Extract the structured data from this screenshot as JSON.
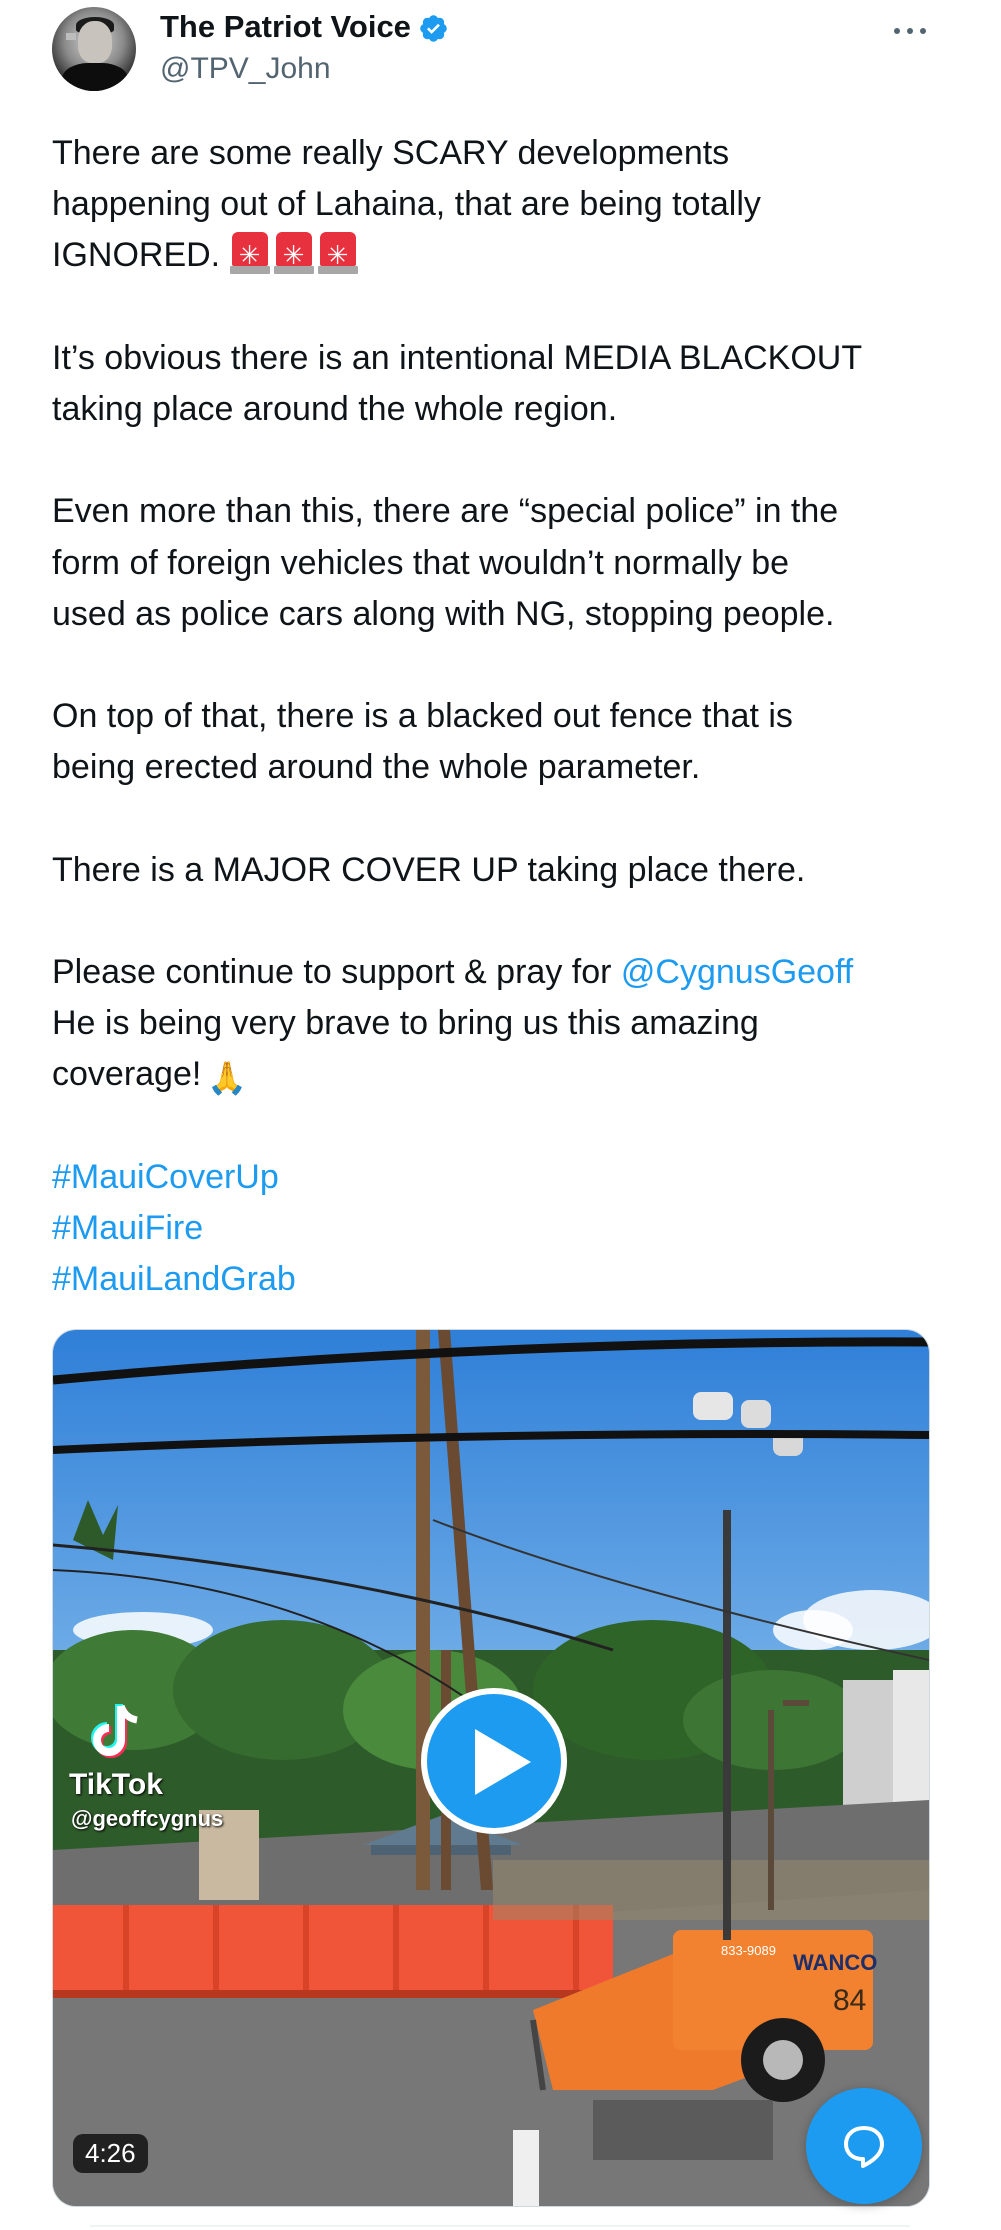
{
  "author": {
    "display_name": "The Patriot Voice",
    "handle": "@TPV_John",
    "verified_icon": "verified-badge-icon",
    "more_icon": "more-horizontal-icon"
  },
  "tweet": {
    "lines": {
      "l1": "There are some really SCARY developments",
      "l2": "happening out of Lahaina, that are being totally",
      "l3": "IGNORED.",
      "l4": "It’s obvious there is an intentional MEDIA BLACKOUT",
      "l5": "taking place around the whole region.",
      "l6": "Even more than this, there are “special police” in the",
      "l7": "form of foreign vehicles that wouldn’t normally be",
      "l8": "used as police cars along with NG, stopping people.",
      "l9": "On top of that, there is a blacked out fence that is",
      "l10": "being erected around the whole parameter.",
      "l11": "There is a MAJOR COVER UP taking place there.",
      "l12": "Please continue to support & pray for",
      "mention": "@CygnusGeoff",
      "l13": "He is being very brave to bring us this amazing",
      "l14": "coverage!"
    },
    "emoji": {
      "siren": "police-car-light-emoji",
      "hands": "folded-hands-emoji"
    },
    "hashtags": [
      "#MauiCoverUp",
      "#MauiFire",
      "#MauiLandGrab"
    ]
  },
  "video": {
    "watermark_brand": "TikTok",
    "watermark_handle": "@geoffcygnus",
    "duration": "4:26",
    "play_icon": "play-icon",
    "generator_label": "WANCO",
    "generator_number": "84",
    "generator_phone": "833-9089"
  },
  "fab": {
    "icon": "chat-bubble-icon"
  },
  "colors": {
    "link": "#1d9bf0",
    "text": "#0f1419",
    "secondary": "#536471",
    "siren_red": "#e8313f"
  }
}
